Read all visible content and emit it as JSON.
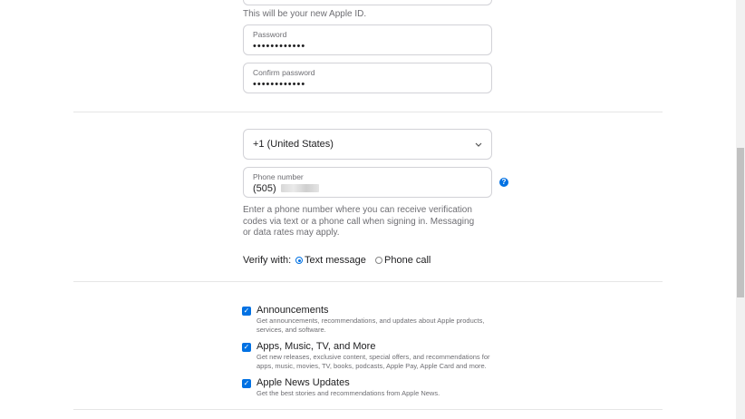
{
  "apple_id": {
    "hint": "This will be your new Apple ID."
  },
  "password": {
    "label": "Password",
    "value": "••••••••••••"
  },
  "confirm_password": {
    "label": "Confirm password",
    "value": "••••••••••••"
  },
  "country_code": {
    "selected": "+1 (United States)"
  },
  "phone": {
    "label": "Phone number",
    "prefix": "(505)",
    "help_icon": "question-mark-icon"
  },
  "phone_hint": "Enter a phone number where you can receive verification codes via text or a phone call when signing in. Messaging or data rates may apply.",
  "verify": {
    "label": "Verify with:",
    "options": [
      "Text message",
      "Phone call"
    ],
    "selected": "Text message"
  },
  "subscriptions": [
    {
      "title": "Announcements",
      "desc": "Get announcements, recommendations, and updates about Apple products, services, and software.",
      "checked": true
    },
    {
      "title": "Apps, Music, TV, and More",
      "desc": "Get new releases, exclusive content, special offers, and recommendations for apps, music, movies, TV, books, podcasts, Apple Pay, Apple Card and more.",
      "checked": true
    },
    {
      "title": "Apple News Updates",
      "desc": "Get the best stories and recommendations from Apple News.",
      "checked": true
    }
  ],
  "colors": {
    "accent": "#0071e3",
    "border": "#d2d2d7",
    "muted": "#6e6e73"
  }
}
